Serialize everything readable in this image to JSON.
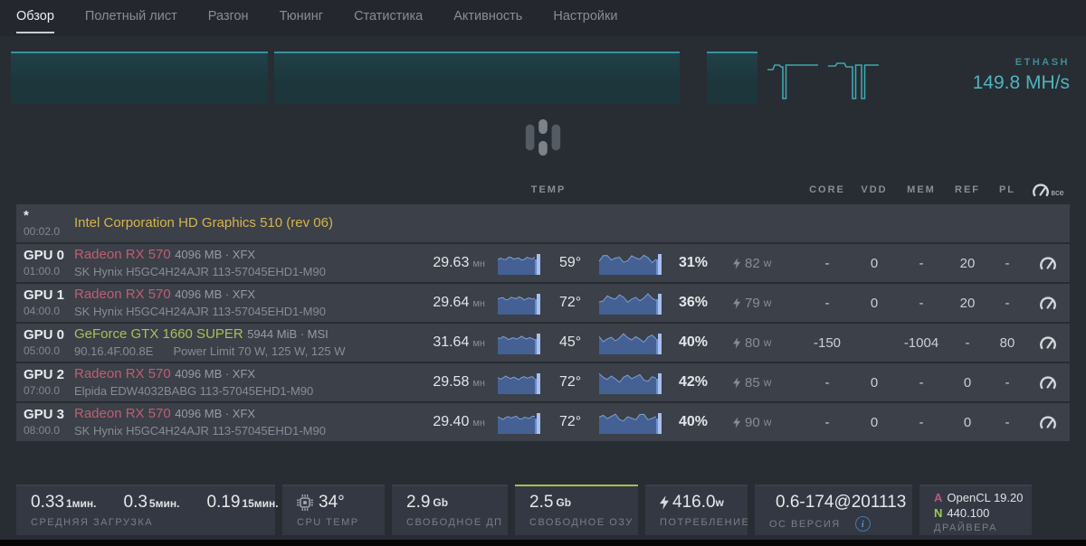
{
  "nav": {
    "tabs": [
      {
        "label": "Обзор",
        "active": true
      },
      {
        "label": "Полетный лист"
      },
      {
        "label": "Разгон"
      },
      {
        "label": "Тюнинг"
      },
      {
        "label": "Статистика"
      },
      {
        "label": "Активность"
      },
      {
        "label": "Настройки"
      }
    ]
  },
  "summary": {
    "algo": "ETHASH",
    "hashrate": "149.8 MH/s"
  },
  "table": {
    "headers": {
      "temp": "TEMP",
      "core": "CORE",
      "vdd": "VDD",
      "mem": "MEM",
      "ref": "REF",
      "pl": "PL",
      "all_label": "все"
    },
    "units": {
      "hash": "мн",
      "power": "w"
    },
    "rows": [
      {
        "id": "*",
        "bus": "00:02.0",
        "name": "Intel Corporation HD Graphics 510 (rev 06)",
        "brand": "intel"
      },
      {
        "id": "GPU 0",
        "bus": "01:00.0",
        "name": "Radeon RX 570",
        "brand": "amd",
        "suffix": "4096 MB · XFX",
        "subtitle": "SK Hynix H5GC4H24AJR 113-57045EHD1-M90",
        "hashrate": "29.63",
        "temp": "59°",
        "fan": "31%",
        "power": "82",
        "core": "-",
        "vdd": "0",
        "mem": "-",
        "ref": "20",
        "pl": "-"
      },
      {
        "id": "GPU 1",
        "bus": "04:00.0",
        "name": "Radeon RX 570",
        "brand": "amd",
        "suffix": "4096 MB · XFX",
        "subtitle": "SK Hynix H5GC4H24AJR 113-57045EHD1-M90",
        "hashrate": "29.64",
        "temp": "72°",
        "fan": "36%",
        "power": "79",
        "core": "-",
        "vdd": "0",
        "mem": "-",
        "ref": "20",
        "pl": "-"
      },
      {
        "id": "GPU 0",
        "bus": "05:00.0",
        "name": "GeForce GTX 1660 SUPER",
        "brand": "nvidia",
        "suffix": "5944 MiB · MSI",
        "subtitle": "90.16.4F.00.8E",
        "subtitle_extra": "Power Limit 70 W, 125 W, 125 W",
        "hashrate": "31.64",
        "temp": "45°",
        "fan": "40%",
        "power": "80",
        "core": "-150",
        "vdd": "",
        "mem": "-1004",
        "ref": "-",
        "pl": "80"
      },
      {
        "id": "GPU 2",
        "bus": "07:00.0",
        "name": "Radeon RX 570",
        "brand": "amd",
        "suffix": "4096 MB · XFX",
        "subtitle": "Elpida EDW4032BABG 113-57045EHD1-M90",
        "hashrate": "29.58",
        "temp": "72°",
        "fan": "42%",
        "power": "85",
        "core": "-",
        "vdd": "0",
        "mem": "-",
        "ref": "0",
        "pl": "-"
      },
      {
        "id": "GPU 3",
        "bus": "08:00.0",
        "name": "Radeon RX 570",
        "brand": "amd",
        "suffix": "4096 MB · XFX",
        "subtitle": "SK Hynix H5GC4H24AJR 113-57045EHD1-M90",
        "hashrate": "29.40",
        "temp": "72°",
        "fan": "40%",
        "power": "90",
        "core": "-",
        "vdd": "0",
        "mem": "-",
        "ref": "0",
        "pl": "-"
      }
    ]
  },
  "footer": {
    "load": {
      "values": [
        {
          "v": "0.33",
          "u": "1мин."
        },
        {
          "v": "0.3",
          "u": "5мин."
        },
        {
          "v": "0.19",
          "u": "15мин."
        }
      ],
      "label": "СРЕДНЯЯ ЗАГРУЗКА"
    },
    "cpu_temp": {
      "value": "34°",
      "label": "CPU TEMP"
    },
    "free_disk": {
      "value": "2.9",
      "unit": "Gb",
      "label": "СВОБОДНОЕ ДП"
    },
    "free_ram": {
      "value": "2.5",
      "unit": "Gb",
      "label": "СВОБОДНОЕ ОЗУ"
    },
    "power_draw": {
      "value": "416.0",
      "unit": "w",
      "label": "ПОТРЕБЛЕНИЕ"
    },
    "os_version": {
      "value": "0.6-174@201113",
      "label": "ОС ВЕРСИЯ",
      "info": "i"
    },
    "drivers": {
      "items": [
        {
          "badge": "A",
          "text": "OpenCL 19.20"
        },
        {
          "badge": "N",
          "text": "440.100"
        }
      ],
      "label": "ДРАЙВЕРА"
    }
  },
  "colors": {
    "accent_teal": "#3fa7b0",
    "hashrate_teal": "#4fb3be",
    "amd_name": "#c05e70",
    "nvidia_name": "#a9c153",
    "intel_name": "#d8b44a",
    "ram_highlight": "#a0c24a",
    "driver_amd_badge": "#c2567d",
    "driver_nvidia_badge": "#9acd4f",
    "info_blue": "#4a94d6",
    "sparkline_blue": "#46639a"
  }
}
